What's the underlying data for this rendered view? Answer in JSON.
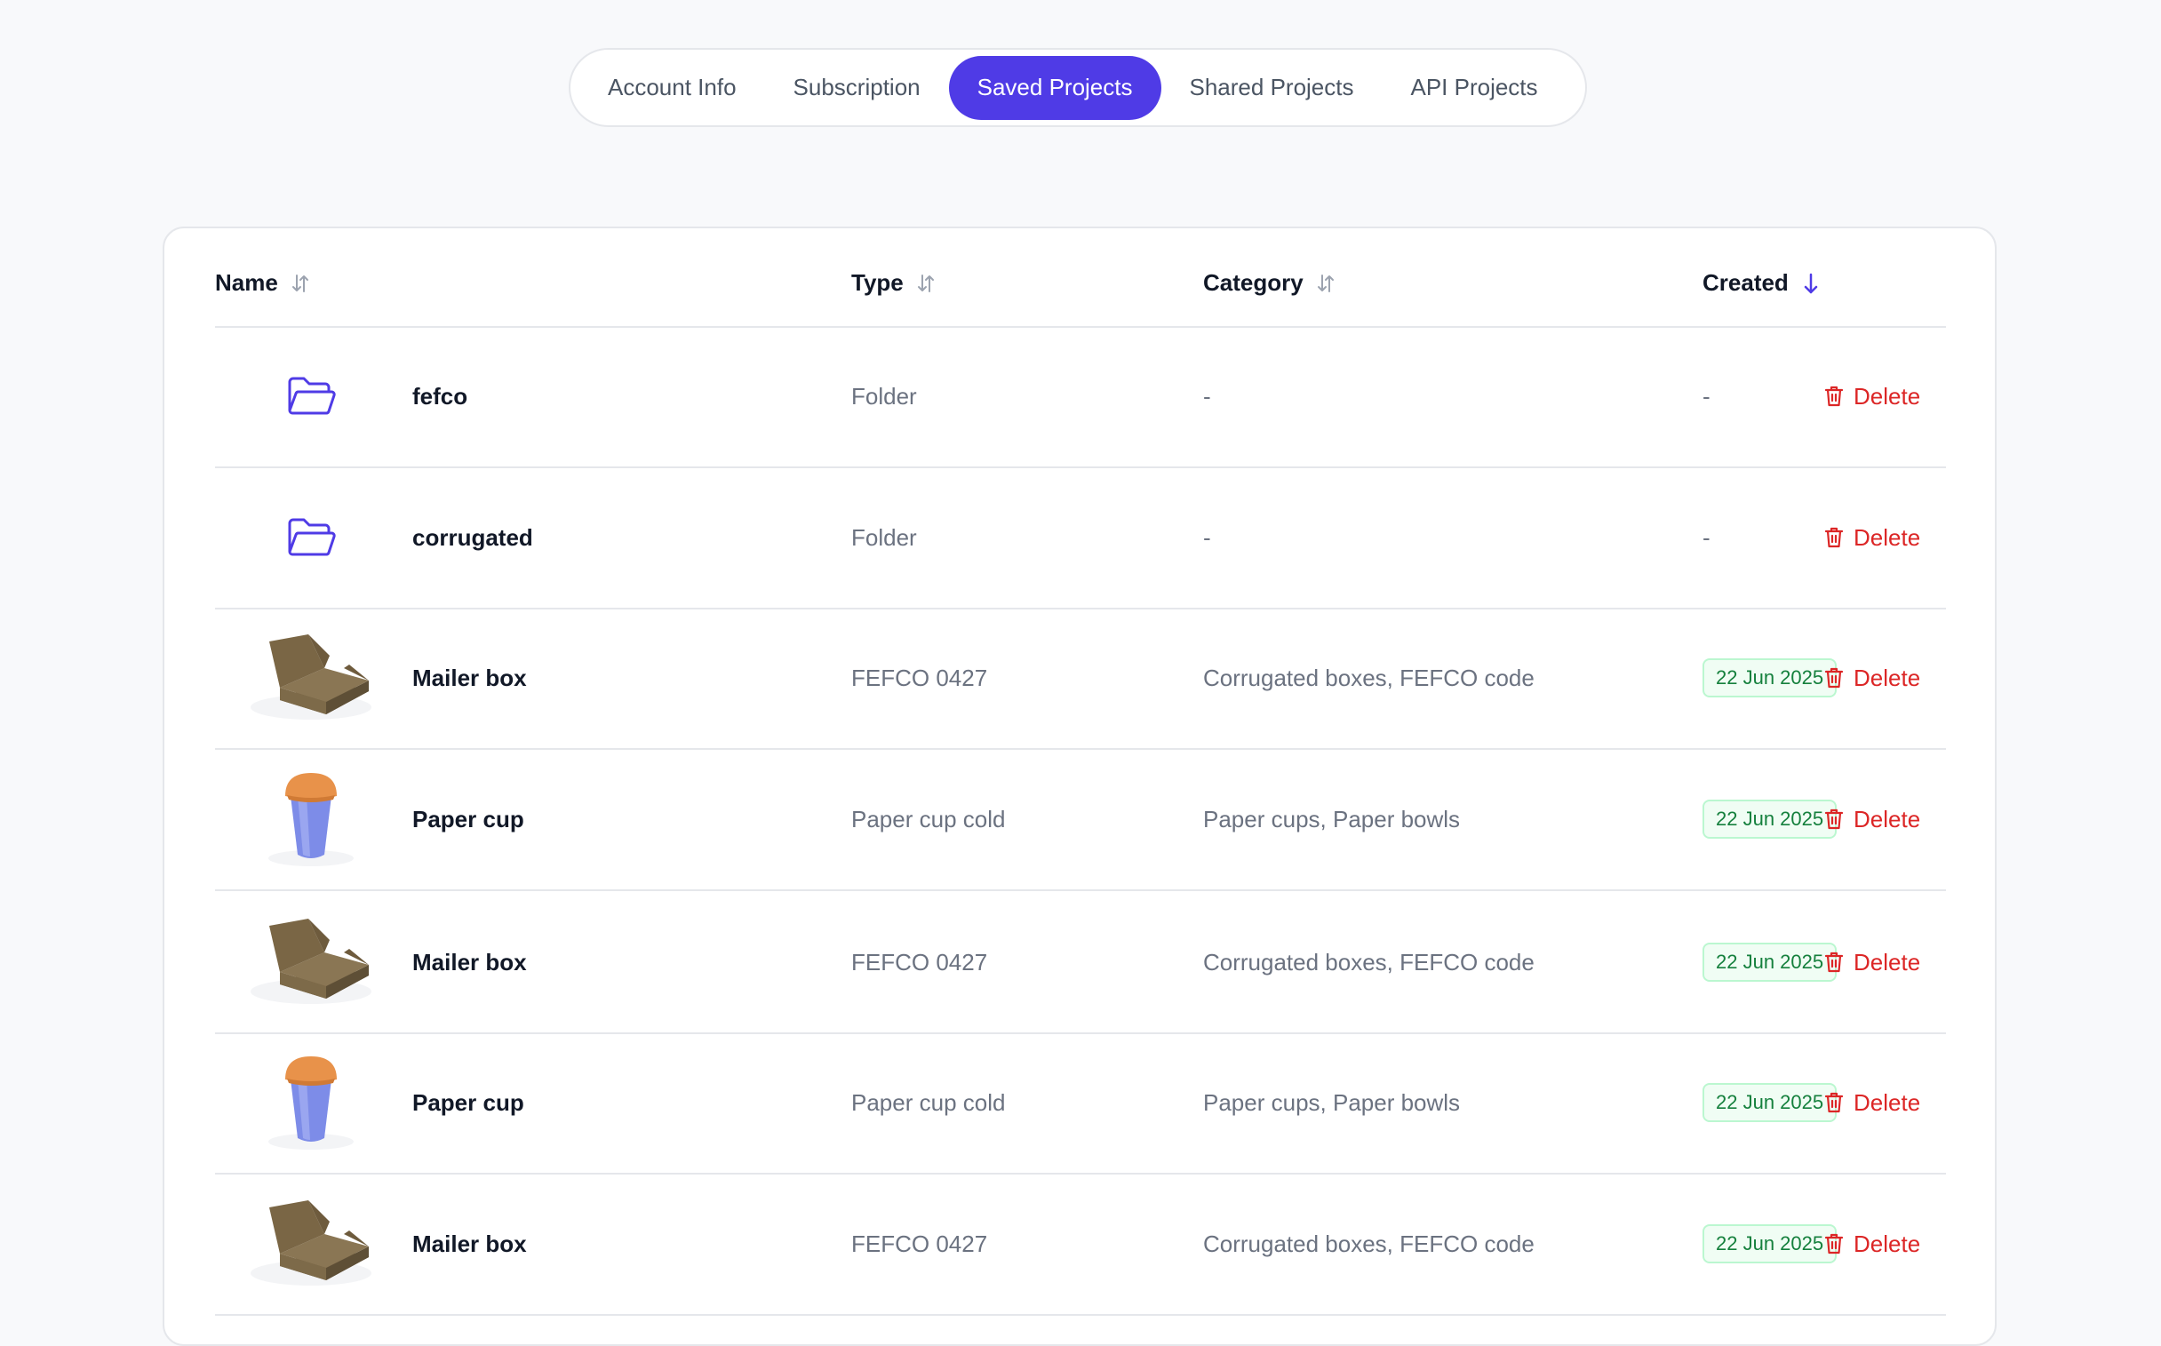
{
  "tabs": [
    {
      "label": "Account Info",
      "active": false
    },
    {
      "label": "Subscription",
      "active": false
    },
    {
      "label": "Saved Projects",
      "active": true
    },
    {
      "label": "Shared Projects",
      "active": false
    },
    {
      "label": "API Projects",
      "active": false
    }
  ],
  "table": {
    "headers": {
      "name": "Name",
      "type": "Type",
      "category": "Category",
      "created": "Created"
    },
    "sort": {
      "column": "created",
      "direction": "desc"
    },
    "rows": [
      {
        "icon": "folder-icon",
        "name": "fefco",
        "type": "Folder",
        "category": "-",
        "created": "-",
        "action": "Delete"
      },
      {
        "icon": "folder-icon",
        "name": "corrugated",
        "type": "Folder",
        "category": "-",
        "created": "-",
        "action": "Delete"
      },
      {
        "icon": "mailer-box-thumbnail",
        "name": "Mailer box",
        "type": "FEFCO 0427",
        "category": "Corrugated boxes, FEFCO code",
        "created": "22 Jun 2025",
        "action": "Delete"
      },
      {
        "icon": "paper-cup-thumbnail",
        "name": "Paper cup",
        "type": "Paper cup cold",
        "category": "Paper cups, Paper bowls",
        "created": "22 Jun 2025",
        "action": "Delete"
      },
      {
        "icon": "mailer-box-thumbnail",
        "name": "Mailer box",
        "type": "FEFCO 0427",
        "category": "Corrugated boxes, FEFCO code",
        "created": "22 Jun 2025",
        "action": "Delete"
      },
      {
        "icon": "paper-cup-thumbnail",
        "name": "Paper cup",
        "type": "Paper cup cold",
        "category": "Paper cups, Paper bowls",
        "created": "22 Jun 2025",
        "action": "Delete"
      },
      {
        "icon": "mailer-box-thumbnail",
        "name": "Mailer box",
        "type": "FEFCO 0427",
        "category": "Corrugated boxes, FEFCO code",
        "created": "22 Jun 2025",
        "action": "Delete"
      }
    ]
  },
  "colors": {
    "accent": "#4f3be6",
    "delete": "#dc2626",
    "badge_text": "#15803d",
    "badge_bg": "#f0fdf4",
    "badge_border": "#bbf7d0",
    "page_bg": "#f8f9fb"
  }
}
